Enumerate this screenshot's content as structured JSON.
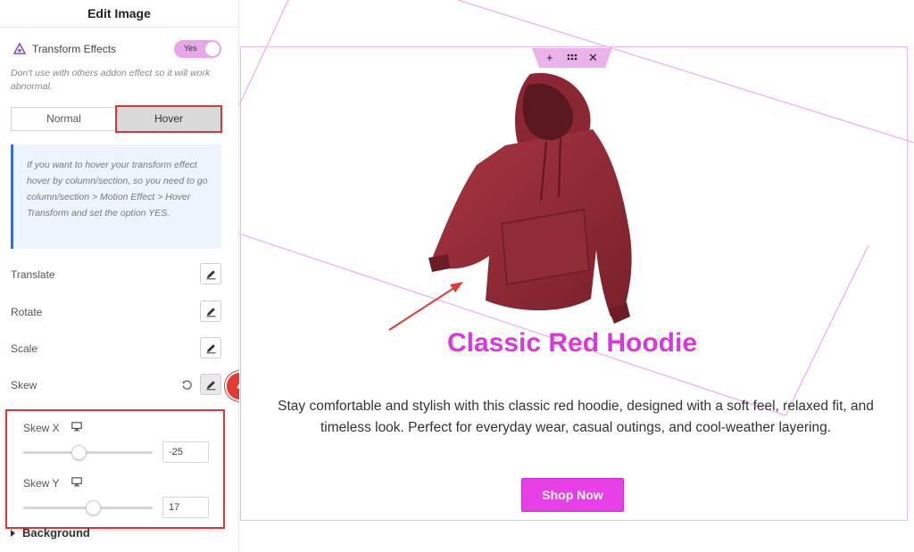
{
  "panel": {
    "title": "Edit Image",
    "transform_effects": {
      "label": "Transform Effects",
      "toggle_text": "Yes",
      "enabled": true
    },
    "hint": "Don't use with others addon effect so it will work abnormal.",
    "tabs": [
      {
        "label": "Normal",
        "active": false
      },
      {
        "label": "Hover",
        "active": true
      }
    ],
    "info": "If you want to hover your transform effect hover by column/section, so you need to go column/section > Motion Effect > Hover Transform and set the option YES.",
    "controls": [
      {
        "label": "Translate"
      },
      {
        "label": "Rotate"
      },
      {
        "label": "Scale"
      },
      {
        "label": "Skew"
      }
    ],
    "step_badge": "4",
    "skew": {
      "x": {
        "label": "Skew X",
        "value": "-25",
        "slider_fraction": 0.43
      },
      "y": {
        "label": "Skew Y",
        "value": "17",
        "slider_fraction": 0.54
      }
    },
    "background_section": "Background"
  },
  "canvas": {
    "widget_tab_icons": [
      "plus-icon",
      "drag-handle-icon",
      "close-icon"
    ],
    "product_title": "Classic Red Hoodie",
    "description": "Stay comfortable and stylish with this classic red hoodie, designed with a soft feel, relaxed fit, and timeless look. Perfect for everyday wear, casual outings, and cool-weather layering.",
    "button_label": "Shop Now"
  },
  "colors": {
    "accent": "#d83ad8",
    "button": "#e63fe6",
    "highlight_red": "#d63b3b",
    "hoodie": "#8e2a35",
    "toggle": "#e8a5e8",
    "info_border": "#3a6fd6"
  }
}
